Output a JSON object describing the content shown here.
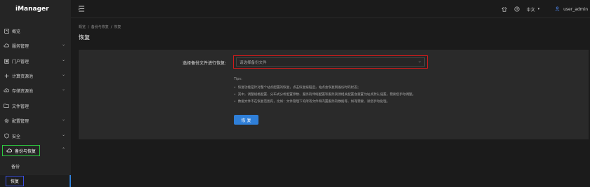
{
  "app": {
    "title": "iManager"
  },
  "sidebar": {
    "items": [
      {
        "label": "概览",
        "icon": "dashboard-icon",
        "has_children": false
      },
      {
        "label": "服务管理",
        "icon": "cloud-icon",
        "has_children": true
      },
      {
        "label": "门户管理",
        "icon": "portal-icon",
        "has_children": true
      },
      {
        "label": "计算资源池",
        "icon": "compute-icon",
        "has_children": true
      },
      {
        "label": "存储资源池",
        "icon": "storage-icon",
        "has_children": true
      },
      {
        "label": "文件管理",
        "icon": "folder-icon",
        "has_children": false
      },
      {
        "label": "配置管理",
        "icon": "gear-icon",
        "has_children": true
      },
      {
        "label": "安全",
        "icon": "shield-icon",
        "has_children": true
      },
      {
        "label": "备份与恢复",
        "icon": "backup-icon",
        "has_children": true,
        "expanded": true
      }
    ],
    "sub_items": [
      {
        "label": "备份"
      },
      {
        "label": "恢复",
        "selected": true
      }
    ]
  },
  "header": {
    "language": "中文",
    "username": "user_admin"
  },
  "breadcrumb": [
    "概览",
    "备份与恢复",
    "恢复"
  ],
  "page": {
    "title": "恢复",
    "form_label": "选择备份文件进行恢复:",
    "select_placeholder": "请选择备份文件",
    "tips_title": "Tips:",
    "tips": [
      "恢复功能是针对整个站点配置的恢复，点击恢复按钮后，站点会恢复到备份时的状态；",
      "其中，调整规格配置、分布式分析配置参数、服务的伸缩配置等服务资源相关配置会重置为站点默认设置，需要您手动调整。",
      "数据文件不在恢复范围内，比如：文件管理下的所有文件和内置服务的数据等，如有需要，请您手动处理。"
    ],
    "restore_button": "恢 复"
  },
  "colors": {
    "accent": "#2f7fd8",
    "highlight_red": "#d11b1b",
    "highlight_green": "#2ecc40",
    "highlight_blue": "#3a4fe0"
  }
}
